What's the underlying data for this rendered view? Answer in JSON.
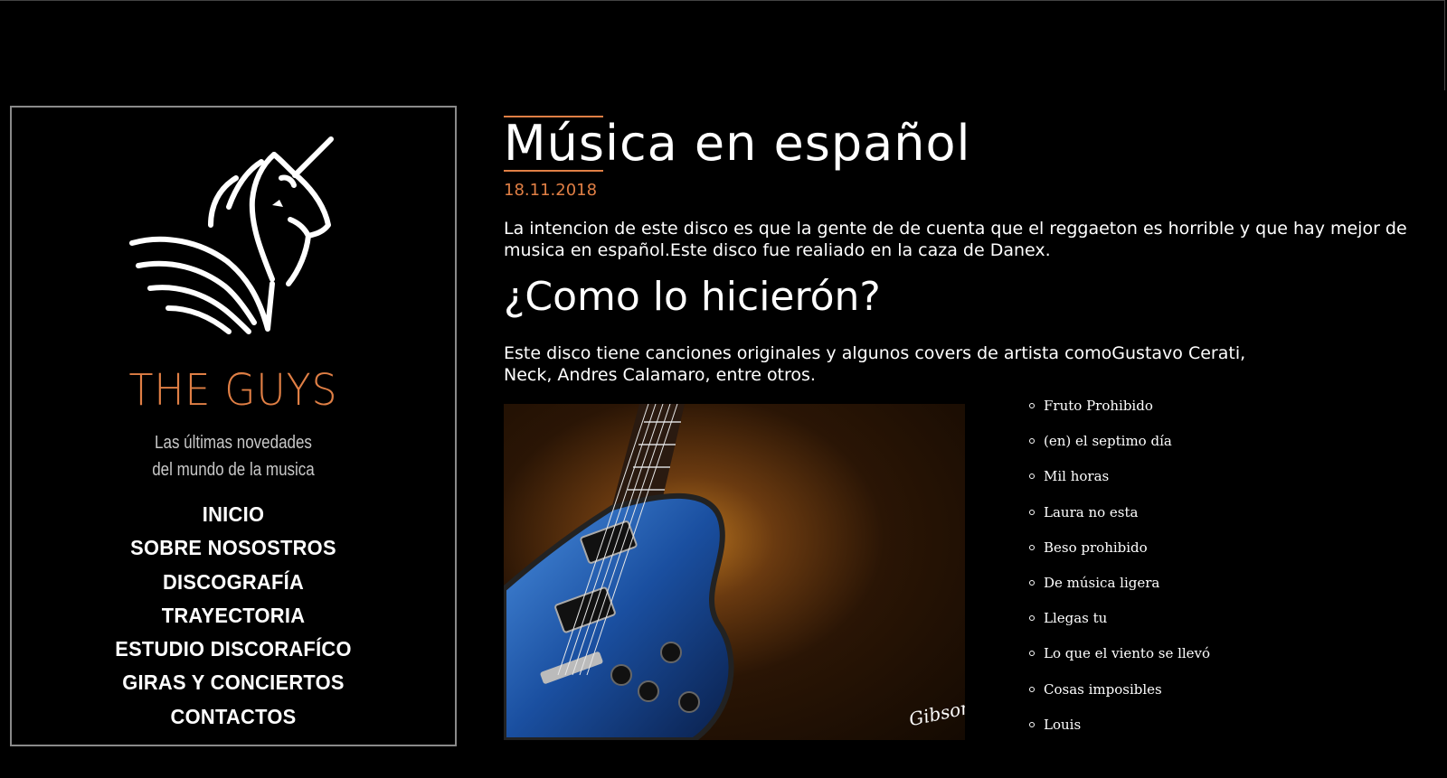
{
  "sidebar": {
    "brand": "THE GUYS",
    "tagline_line1": "Las últimas novedades",
    "tagline_line2": "del mundo de la musica",
    "nav": [
      "INICIO",
      "SOBRE NOSOSTROS",
      "DISCOGRAFÍA",
      "TRAYECTORIA",
      "ESTUDIO DISCORAFÍCO",
      "GIRAS Y CONCIERTOS",
      "CONTACTOS"
    ]
  },
  "main": {
    "title": "Música en español",
    "date": "18.11.2018",
    "intro": "La intencion de este disco es que la gente de de cuenta que el reggaeton es horrible y que hay mejor de musica en español.Este disco fue realiado en la caza de Danex.",
    "subheading": "¿Como lo hicierón?",
    "description": "Este disco tiene canciones originales y algunos covers de artista comoGustavo Cerati, Neck, Andres Calamaro, entre otros.",
    "image_logo_text": "Gibson"
  },
  "tracks": [
    "Fruto Prohibido",
    "(en) el septimo día",
    "Mil horas",
    "Laura no esta",
    "Beso prohibido",
    "De música ligera",
    "Llegas tu",
    "Lo que el viento se llevó",
    "Cosas imposibles",
    "Louis"
  ],
  "colors": {
    "accent": "#e07f45",
    "background": "#000000",
    "border": "#8a8a8a"
  }
}
